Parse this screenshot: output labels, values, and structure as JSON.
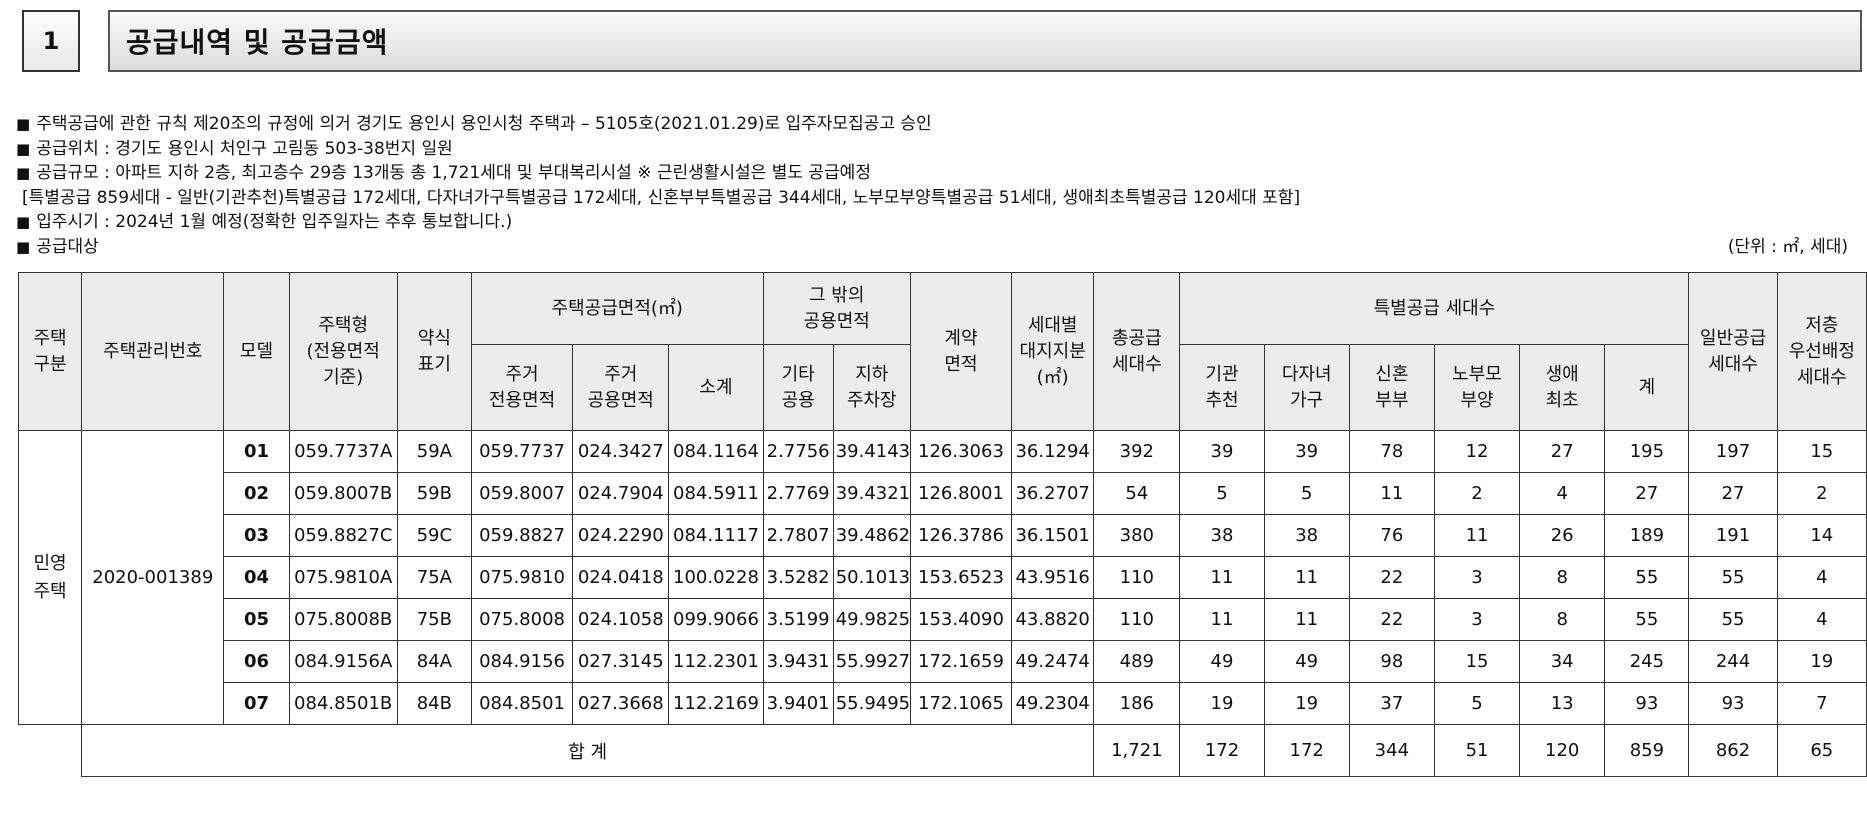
{
  "section": {
    "number": "1",
    "title": "공급내역 및 공급금액"
  },
  "notes": {
    "bullet": "■",
    "lines": [
      "주택공급에 관한 규칙 제20조의 규정에 의거 경기도 용인시 용인시청 주택과 – 5105호(2021.01.29)로 입주자모집공고 승인",
      "공급위치 : 경기도 용인시 처인구 고림동 503-38번지 일원",
      "공급규모 : 아파트 지하 2층, 최고층수 29층 13개동 총 1,721세대 및 부대복리시설 ※ 근린생활시설은 별도 공급예정"
    ],
    "sub_line": "[특별공급 859세대 - 일반(기관추천)특별공급 172세대, 다자녀가구특별공급 172세대, 신혼부부특별공급 344세대, 노부모부양특별공급 51세대, 생애최초특별공급 120세대 포함]",
    "move_in": "입주시기 : 2024년 1월 예정(정확한 입주일자는 추후 통보합니다.)",
    "target": "공급대상",
    "unit": "(단위 : ㎡, 세대)"
  },
  "table": {
    "headers": {
      "house_type_div": "주택\n구분",
      "mgmt_no": "주택관리번호",
      "model": "모델",
      "house_type": "주택형\n(전용면적\n기준)",
      "abbr": "약식\n표기",
      "supply_area": "주택공급면적(㎡)",
      "excl_area": "주거\n전용면적",
      "common_area": "주거\n공용면적",
      "subtotal": "소계",
      "other_common": "그 밖의\n공용면적",
      "other": "기타\n공용",
      "parking": "지하\n주차장",
      "contract_area": "계약\n면적",
      "land_share": "세대별\n대지지분\n(㎡)",
      "total_units": "총공급\n세대수",
      "special_units": "특별공급 세대수",
      "inst": "기관\n추천",
      "multi_child": "다자녀\n가구",
      "newlywed": "신혼\n부부",
      "elderly": "노부모\n부양",
      "first_time": "생애\n최초",
      "special_sum": "계",
      "general": "일반공급\n세대수",
      "low_floor": "저층\n우선배정\n세대수"
    },
    "type_div": "민영\n주택",
    "mgmt_number": "2020-001389",
    "rows": [
      [
        "01",
        "059.7737A",
        "59A",
        "059.7737",
        "024.3427",
        "084.1164",
        "2.7756",
        "39.4143",
        "126.3063",
        "36.1294",
        "392",
        "39",
        "39",
        "78",
        "12",
        "27",
        "195",
        "197",
        "15"
      ],
      [
        "02",
        "059.8007B",
        "59B",
        "059.8007",
        "024.7904",
        "084.5911",
        "2.7769",
        "39.4321",
        "126.8001",
        "36.2707",
        "54",
        "5",
        "5",
        "11",
        "2",
        "4",
        "27",
        "27",
        "2"
      ],
      [
        "03",
        "059.8827C",
        "59C",
        "059.8827",
        "024.2290",
        "084.1117",
        "2.7807",
        "39.4862",
        "126.3786",
        "36.1501",
        "380",
        "38",
        "38",
        "76",
        "11",
        "26",
        "189",
        "191",
        "14"
      ],
      [
        "04",
        "075.9810A",
        "75A",
        "075.9810",
        "024.0418",
        "100.0228",
        "3.5282",
        "50.1013",
        "153.6523",
        "43.9516",
        "110",
        "11",
        "11",
        "22",
        "3",
        "8",
        "55",
        "55",
        "4"
      ],
      [
        "05",
        "075.8008B",
        "75B",
        "075.8008",
        "024.1058",
        "099.9066",
        "3.5199",
        "49.9825",
        "153.4090",
        "43.8820",
        "110",
        "11",
        "11",
        "22",
        "3",
        "8",
        "55",
        "55",
        "4"
      ],
      [
        "06",
        "084.9156A",
        "84A",
        "084.9156",
        "027.3145",
        "112.2301",
        "3.9431",
        "55.9927",
        "172.1659",
        "49.2474",
        "489",
        "49",
        "49",
        "98",
        "15",
        "34",
        "245",
        "244",
        "19"
      ],
      [
        "07",
        "084.8501B",
        "84B",
        "084.8501",
        "027.3668",
        "112.2169",
        "3.9401",
        "55.9495",
        "172.1065",
        "49.2304",
        "186",
        "19",
        "19",
        "37",
        "5",
        "13",
        "93",
        "93",
        "7"
      ]
    ],
    "total": {
      "label": "합 계",
      "values": [
        "1,721",
        "172",
        "172",
        "344",
        "51",
        "120",
        "859",
        "862",
        "65"
      ]
    }
  }
}
